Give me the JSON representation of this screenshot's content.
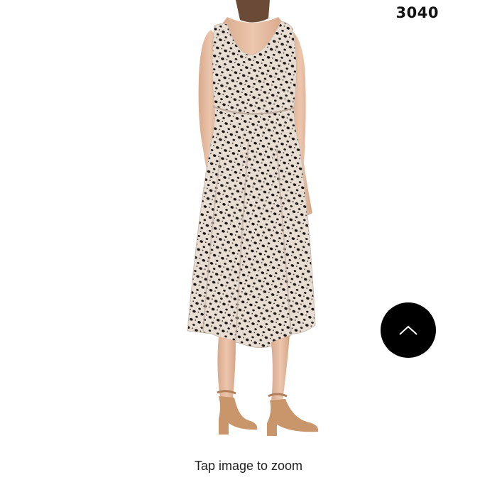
{
  "product_image": {
    "subject": "woman in sleeveless dotted midi dress with tan strappy heeled sandals, back view",
    "dress_color": "#e8ddd2",
    "dot_color": "#1a1512",
    "skin_color": "#e2b89c",
    "sandal_color": "#c9956b"
  },
  "item_number": "3040",
  "scroll_top_button": {
    "icon": "chevron-up-icon",
    "background": "#000000",
    "icon_color": "#ffffff"
  },
  "zoom_hint": "Tap image to zoom"
}
